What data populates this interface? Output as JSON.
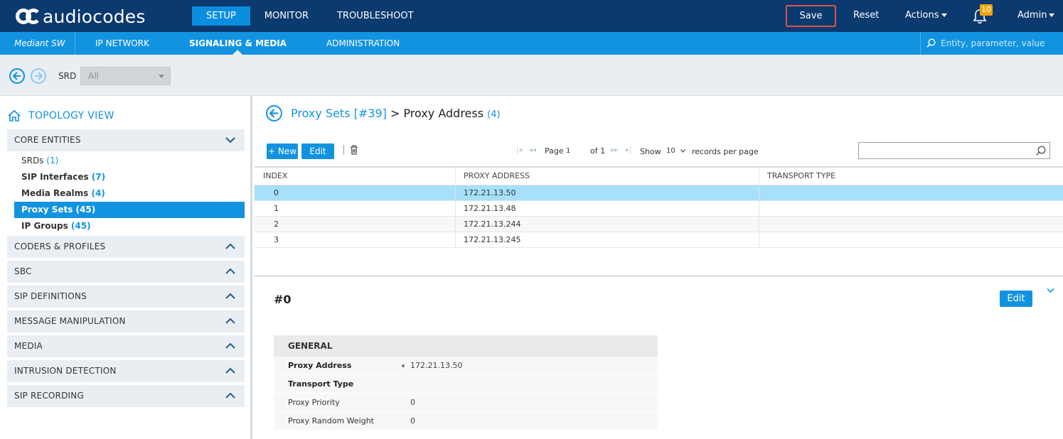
{
  "header": {
    "logo_text": "audiocodes",
    "nav": [
      {
        "label": "SETUP",
        "active": true
      },
      {
        "label": "MONITOR",
        "active": false
      },
      {
        "label": "TROUBLESHOOT",
        "active": false
      }
    ],
    "save_label": "Save",
    "reset_label": "Reset",
    "actions_label": "Actions",
    "notification_count": "10",
    "user_label": "Admin"
  },
  "subheader": {
    "product": "Mediant SW",
    "nav": [
      {
        "label": "IP NETWORK",
        "active": false
      },
      {
        "label": "SIGNALING & MEDIA",
        "active": true
      },
      {
        "label": "ADMINISTRATION",
        "active": false
      }
    ],
    "search_placeholder": "Entity, parameter, value"
  },
  "srd_bar": {
    "label": "SRD",
    "value": "All"
  },
  "sidebar": {
    "topology_label": "TOPOLOGY VIEW",
    "core_section": "CORE ENTITIES",
    "core_items": [
      {
        "label": "SRDs",
        "count": "(1)"
      },
      {
        "label": "SIP Interfaces",
        "count": "(7)"
      },
      {
        "label": "Media Realms",
        "count": "(4)"
      },
      {
        "label": "Proxy Sets",
        "count": "(45)"
      },
      {
        "label": "IP Groups",
        "count": "(45)"
      }
    ],
    "sections": [
      "CODERS & PROFILES",
      "SBC",
      "SIP DEFINITIONS",
      "MESSAGE MANIPULATION",
      "MEDIA",
      "INTRUSION DETECTION",
      "SIP RECORDING"
    ]
  },
  "main": {
    "breadcrumb_parent": "Proxy Sets [#39]",
    "breadcrumb_sep": " > ",
    "breadcrumb_current": "Proxy Address",
    "breadcrumb_count": "(4)",
    "new_label": "+ New",
    "edit_label": "Edit",
    "pager": {
      "page_label": "Page",
      "page_value": "1",
      "of_label": "of 1",
      "show_label": "Show",
      "show_value": "10",
      "records_label": "records per page"
    },
    "table": {
      "columns": [
        "INDEX",
        "PROXY ADDRESS",
        "TRANSPORT TYPE"
      ],
      "rows": [
        {
          "index": "0",
          "address": "172.21.13.50",
          "transport": ""
        },
        {
          "index": "1",
          "address": "172.21.13.48",
          "transport": ""
        },
        {
          "index": "2",
          "address": "172.21.13.244",
          "transport": ""
        },
        {
          "index": "3",
          "address": "172.21.13.245",
          "transport": ""
        }
      ]
    },
    "record": {
      "title": "#0",
      "edit_label": "Edit",
      "group_title": "GENERAL",
      "fields": [
        {
          "key": "Proxy Address",
          "value": "172.21.13.50"
        },
        {
          "key": "Transport Type",
          "value": ""
        },
        {
          "key": "Proxy Priority",
          "value": "0"
        },
        {
          "key": "Proxy Random Weight",
          "value": "0"
        }
      ]
    }
  },
  "colors": {
    "topbar": "#0b3a6e",
    "accent": "#1293e0",
    "selected_row": "#a6e0fa",
    "save_border": "#e0524b",
    "badge": "#f0a30a"
  }
}
